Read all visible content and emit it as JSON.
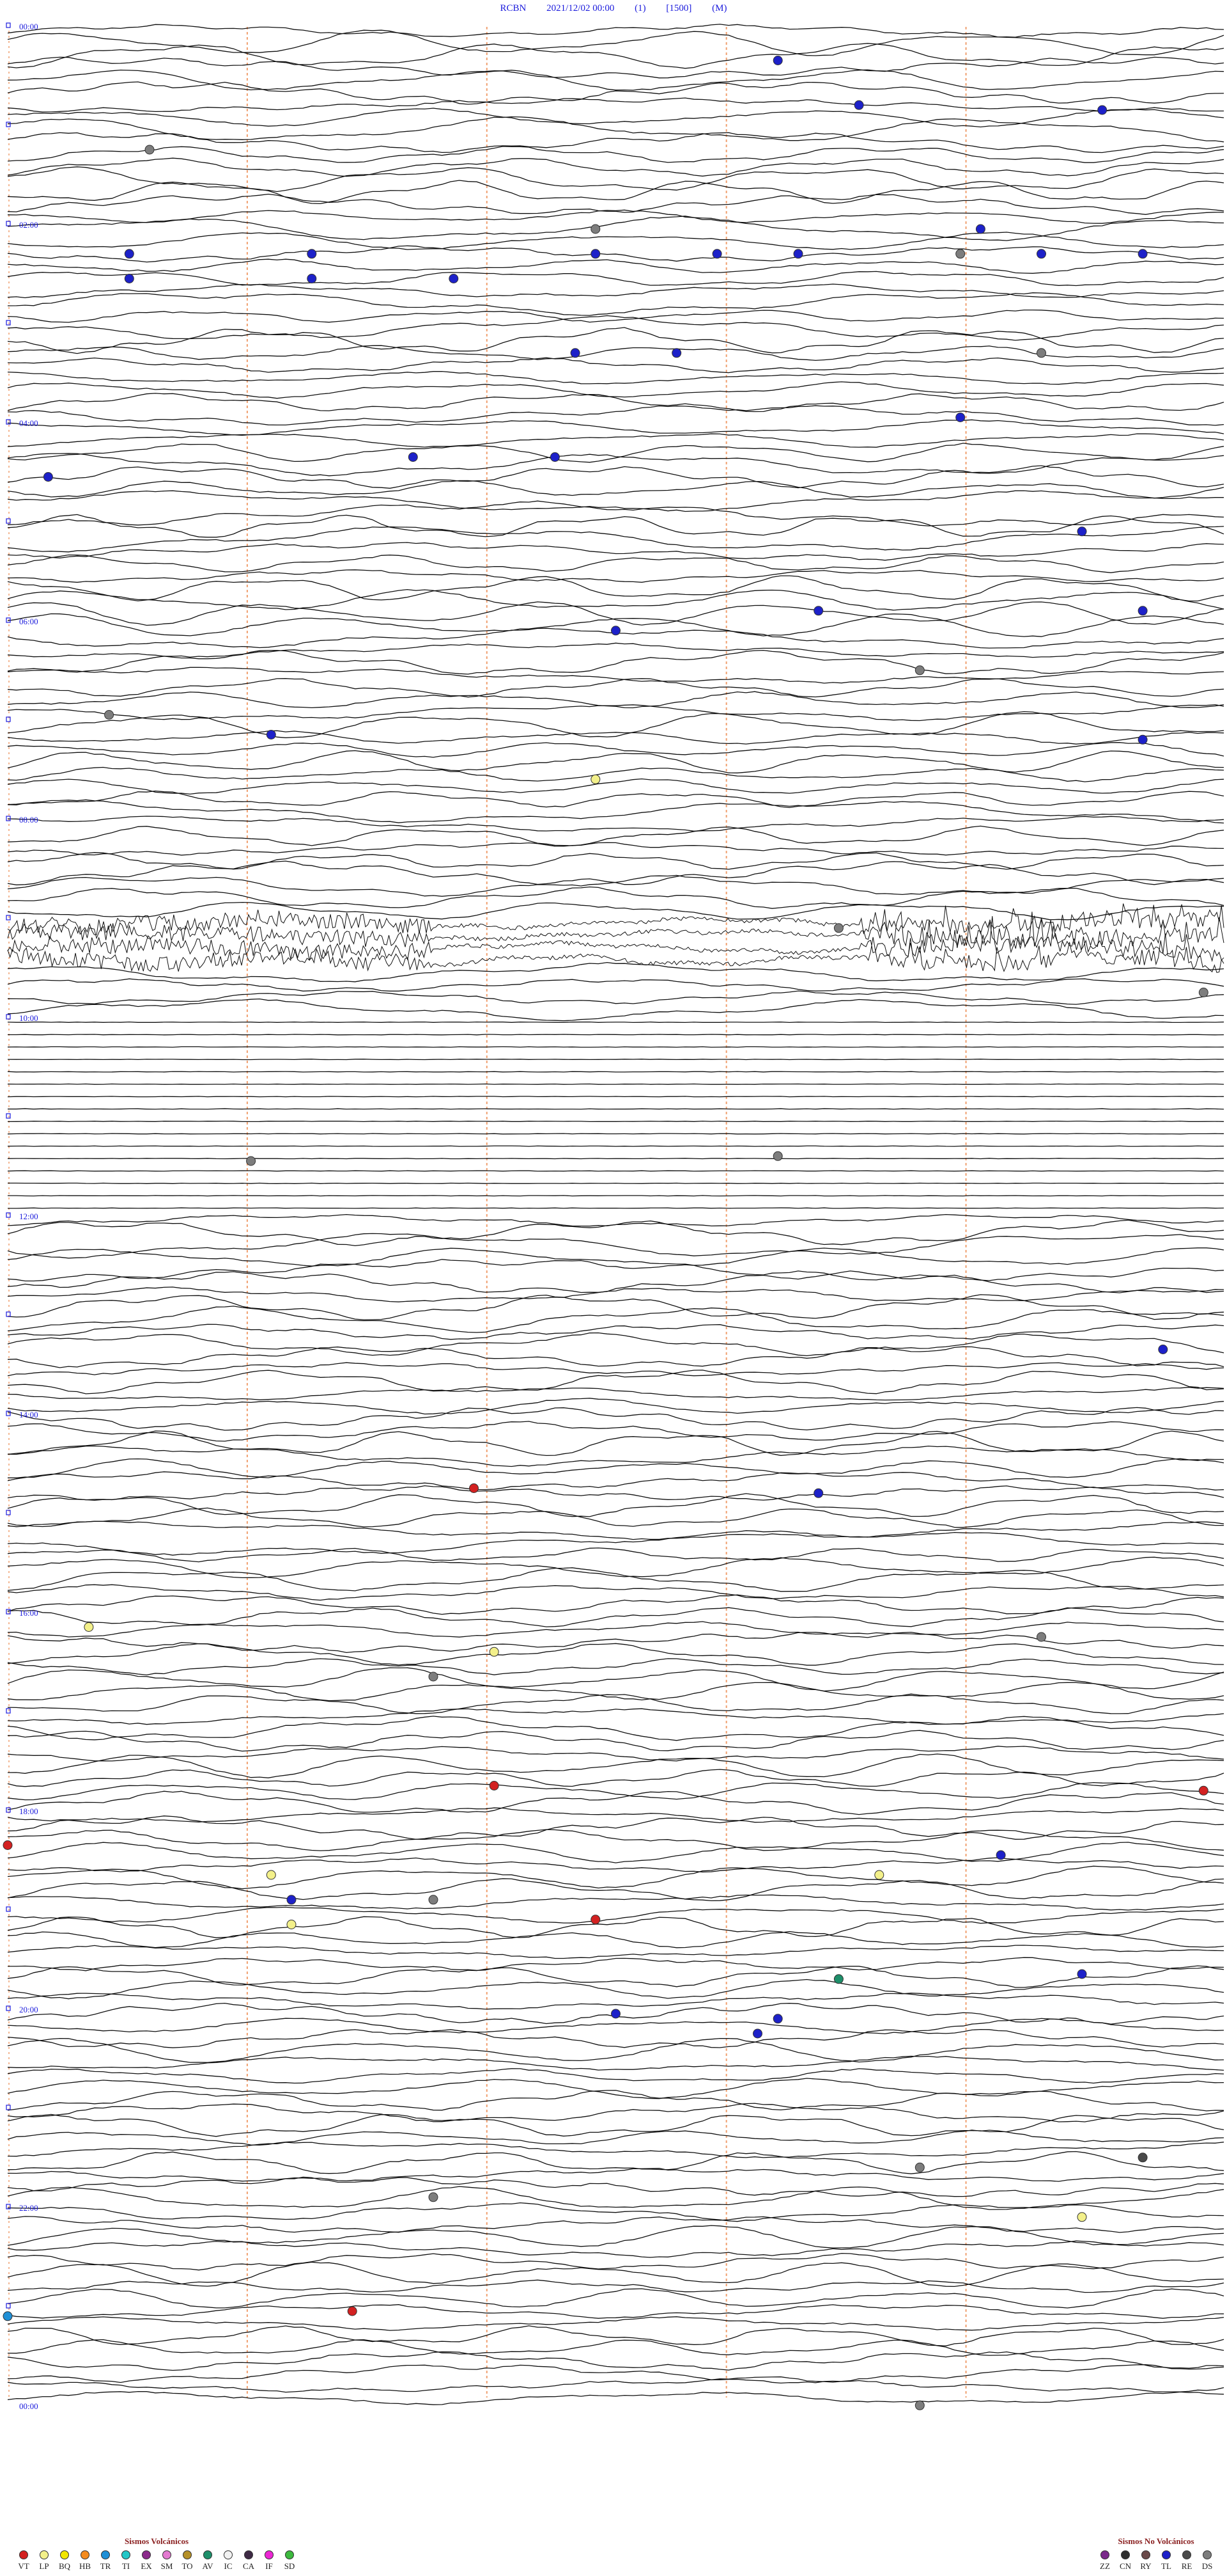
{
  "header": {
    "station": "RCBN",
    "datetime": "2021/12/02 00:00",
    "channel": "(1)",
    "scale": "[1500]",
    "mode": "(M)"
  },
  "chart_data": {
    "type": "helicorder",
    "hour_labels": [
      "00:00",
      "02:00",
      "04:00",
      "06:00",
      "08:00",
      "10:00",
      "12:00",
      "14:00",
      "16:00",
      "18:00",
      "20:00",
      "22:00",
      "00:00"
    ],
    "traces_per_hour": 4,
    "total_hours": 24,
    "vertical_markers_fraction": [
      0.2,
      0.4,
      0.6,
      0.8
    ],
    "segments": [
      {
        "from_hour": 0,
        "to_hour": 9,
        "style": "wavy"
      },
      {
        "from_hour": 9,
        "to_hour": 9.5,
        "style": "tremor"
      },
      {
        "from_hour": 9.5,
        "to_hour": 10,
        "style": "wavy"
      },
      {
        "from_hour": 10,
        "to_hour": 12,
        "style": "flat"
      },
      {
        "from_hour": 12,
        "to_hour": 24,
        "style": "wavy"
      }
    ],
    "events": [
      {
        "hour": 0.3,
        "minute": 38,
        "type": "TL"
      },
      {
        "hour": 0.75,
        "minute": 42,
        "type": "TL"
      },
      {
        "hour": 0.8,
        "minute": 54,
        "type": "TL"
      },
      {
        "hour": 1.2,
        "minute": 7,
        "type": "DS"
      },
      {
        "hour": 2.0,
        "minute": 29,
        "type": "DS"
      },
      {
        "hour": 2.0,
        "minute": 48,
        "type": "TL"
      },
      {
        "hour": 2.25,
        "minute": 6,
        "type": "TL"
      },
      {
        "hour": 2.25,
        "minute": 15,
        "type": "TL"
      },
      {
        "hour": 2.25,
        "minute": 29,
        "type": "TL"
      },
      {
        "hour": 2.25,
        "minute": 35,
        "type": "TL"
      },
      {
        "hour": 2.25,
        "minute": 39,
        "type": "TL"
      },
      {
        "hour": 2.25,
        "minute": 47,
        "type": "DS"
      },
      {
        "hour": 2.25,
        "minute": 51,
        "type": "TL"
      },
      {
        "hour": 2.25,
        "minute": 56,
        "type": "TL"
      },
      {
        "hour": 2.5,
        "minute": 6,
        "type": "TL"
      },
      {
        "hour": 2.5,
        "minute": 15,
        "type": "TL"
      },
      {
        "hour": 2.5,
        "minute": 22,
        "type": "TL"
      },
      {
        "hour": 3.25,
        "minute": 28,
        "type": "TL"
      },
      {
        "hour": 3.25,
        "minute": 33,
        "type": "TL"
      },
      {
        "hour": 3.25,
        "minute": 51,
        "type": "DS"
      },
      {
        "hour": 3.9,
        "minute": 47,
        "type": "TL"
      },
      {
        "hour": 4.3,
        "minute": 20,
        "type": "TL"
      },
      {
        "hour": 4.3,
        "minute": 27,
        "type": "TL"
      },
      {
        "hour": 4.5,
        "minute": 2,
        "type": "TL"
      },
      {
        "hour": 5.05,
        "minute": 53,
        "type": "TL"
      },
      {
        "hour": 5.85,
        "minute": 40,
        "type": "TL"
      },
      {
        "hour": 5.85,
        "minute": 56,
        "type": "TL"
      },
      {
        "hour": 6.05,
        "minute": 30,
        "type": "TL"
      },
      {
        "hour": 6.45,
        "minute": 45,
        "type": "DS"
      },
      {
        "hour": 6.9,
        "minute": 5,
        "type": "DS"
      },
      {
        "hour": 7.1,
        "minute": 13,
        "type": "TL"
      },
      {
        "hour": 7.15,
        "minute": 56,
        "type": "TL"
      },
      {
        "hour": 7.55,
        "minute": 29,
        "type": "LP"
      },
      {
        "hour": 9.05,
        "minute": 41,
        "type": "DS"
      },
      {
        "hour": 9.7,
        "minute": 59,
        "type": "DS"
      },
      {
        "hour": 11.4,
        "minute": 12,
        "type": "DS"
      },
      {
        "hour": 11.35,
        "minute": 38,
        "type": "DS"
      },
      {
        "hour": 13.3,
        "minute": 57,
        "type": "TL"
      },
      {
        "hour": 14.7,
        "minute": 23,
        "type": "VT"
      },
      {
        "hour": 14.75,
        "minute": 40,
        "type": "TL"
      },
      {
        "hour": 16.1,
        "minute": 4,
        "type": "LP"
      },
      {
        "hour": 16.2,
        "minute": 51,
        "type": "DS"
      },
      {
        "hour": 16.35,
        "minute": 24,
        "type": "LP"
      },
      {
        "hour": 16.6,
        "minute": 21,
        "type": "DS"
      },
      {
        "hour": 17.75,
        "minute": 59,
        "type": "VT"
      },
      {
        "hour": 17.7,
        "minute": 24,
        "type": "VT"
      },
      {
        "hour": 18.3,
        "minute": 0,
        "type": "VT"
      },
      {
        "hour": 18.4,
        "minute": 49,
        "type": "TL"
      },
      {
        "hour": 18.6,
        "minute": 13,
        "type": "LP"
      },
      {
        "hour": 18.6,
        "minute": 43,
        "type": "LP"
      },
      {
        "hour": 18.85,
        "minute": 14,
        "type": "TL"
      },
      {
        "hour": 18.85,
        "minute": 21,
        "type": "DS"
      },
      {
        "hour": 19.05,
        "minute": 29,
        "type": "VT"
      },
      {
        "hour": 19.1,
        "minute": 14,
        "type": "LP"
      },
      {
        "hour": 19.6,
        "minute": 53,
        "type": "TL"
      },
      {
        "hour": 19.65,
        "minute": 41,
        "type": "AV"
      },
      {
        "hour": 20.0,
        "minute": 30,
        "type": "TL"
      },
      {
        "hour": 20.2,
        "minute": 37,
        "type": "TL"
      },
      {
        "hour": 20.05,
        "minute": 38,
        "type": "TL"
      },
      {
        "hour": 21.45,
        "minute": 56,
        "type": "RE"
      },
      {
        "hour": 21.55,
        "minute": 45,
        "type": "DS"
      },
      {
        "hour": 21.85,
        "minute": 21,
        "type": "DS"
      },
      {
        "hour": 22.05,
        "minute": 53,
        "type": "LP"
      },
      {
        "hour": 23.0,
        "minute": 17,
        "type": "VT"
      },
      {
        "hour": 23.05,
        "minute": 0,
        "type": "TR"
      },
      {
        "hour": 23.95,
        "minute": 45,
        "type": "DS"
      }
    ]
  },
  "legend_volcanic": {
    "title": "Sismos Volcánicos",
    "items": [
      {
        "code": "VT",
        "color": "#d32121"
      },
      {
        "code": "LP",
        "color": "#f3f08a"
      },
      {
        "code": "BQ",
        "color": "#f2e600"
      },
      {
        "code": "HB",
        "color": "#f48b1f"
      },
      {
        "code": "TR",
        "color": "#1f8fd6"
      },
      {
        "code": "TI",
        "color": "#24c7c7"
      },
      {
        "code": "EX",
        "color": "#8b2a8b"
      },
      {
        "code": "SM",
        "color": "#e37ad0"
      },
      {
        "code": "TO",
        "color": "#b59028"
      },
      {
        "code": "AV",
        "color": "#1e8f6a"
      },
      {
        "code": "IC",
        "color": "#f2f2f2"
      },
      {
        "code": "CA",
        "color": "#3e2a45"
      },
      {
        "code": "IF",
        "color": "#ec26d4"
      },
      {
        "code": "SD",
        "color": "#3db93e"
      }
    ]
  },
  "legend_nonvolcanic": {
    "title": "Sismos No Volcánicos",
    "items": [
      {
        "code": "ZZ",
        "color": "#7b2b8b"
      },
      {
        "code": "CN",
        "color": "#2f2f2f"
      },
      {
        "code": "RY",
        "color": "#6a4a4a"
      },
      {
        "code": "TL",
        "color": "#1d21c9"
      },
      {
        "code": "RE",
        "color": "#4a4a4a"
      },
      {
        "code": "DS",
        "color": "#7d7d7d"
      }
    ]
  }
}
